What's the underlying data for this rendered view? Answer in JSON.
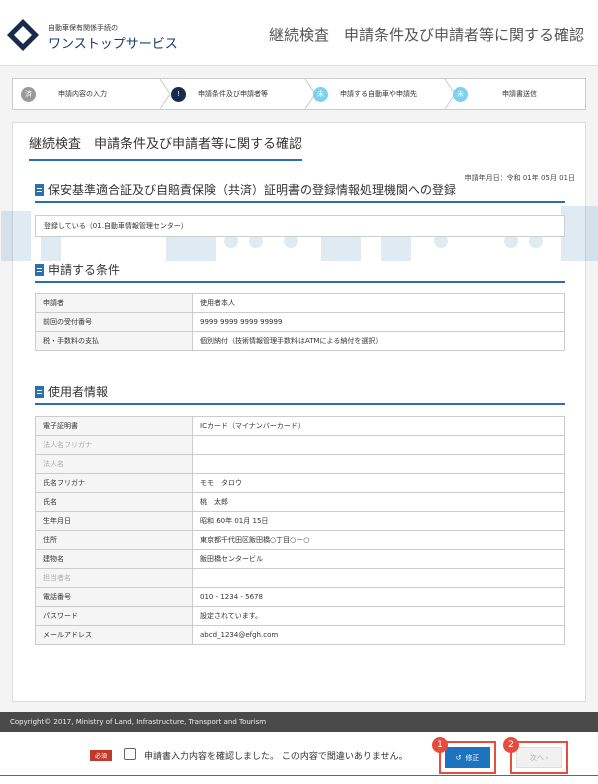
{
  "header": {
    "logo_sub": "自動車保有関係手続の",
    "logo_main": "ワンストップサービス",
    "page_heading": "継続検査　申請条件及び申請者等に関する確認"
  },
  "steps": [
    {
      "icon": "済",
      "label": "申請内容の入力",
      "color": "#999999"
    },
    {
      "icon": "!",
      "label": "申請条件及び申請者等",
      "color": "#1a2a4a"
    },
    {
      "icon": "未",
      "label": "申請する自動車や申請先",
      "color": "#7ecff0"
    },
    {
      "icon": "未",
      "label": "申請書送信",
      "color": "#7ecff0"
    }
  ],
  "card_title": "継続検査　申請条件及び申請者等に関する確認",
  "date_line": "申請年月日：令和 01年 05月 01日",
  "section1": {
    "title": "保安基準適合証及び自賠責保険（共済）証明書の登録情報処理機関への登録",
    "value": "登録している（01.自動車情報管理センター）"
  },
  "section2": {
    "title": "申請する条件",
    "rows": [
      {
        "k": "申請者",
        "v": "使用者本人"
      },
      {
        "k": "前回の受付番号",
        "v": "9999 9999 9999 99999"
      },
      {
        "k": "税・手数料の支払",
        "v": "個別納付（技術情報管理手数料はATMによる納付を選択）"
      }
    ]
  },
  "section3": {
    "title": "使用者情報",
    "rows": [
      {
        "k": "電子証明書",
        "v": "ICカード（マイナンバーカード）"
      },
      {
        "k": "法人名フリガナ",
        "v": ""
      },
      {
        "k": "法人名",
        "v": ""
      },
      {
        "k": "氏名フリガナ",
        "v": "モモ　タロウ"
      },
      {
        "k": "氏名",
        "v": "桃　太郎"
      },
      {
        "k": "生年月日",
        "v": "昭和 60年 01月 15日"
      },
      {
        "k": "住所",
        "v": "東京都千代田区飯田橋○丁目○－○"
      },
      {
        "k": "建物名",
        "v": "飯田橋センタービル"
      },
      {
        "k": "担当者名",
        "v": ""
      },
      {
        "k": "電話番号",
        "v": "010 - 1234 - 5678"
      },
      {
        "k": "パスワード",
        "v": "設定されています。"
      },
      {
        "k": "メールアドレス",
        "v": "abcd_1234@efgh.com"
      }
    ]
  },
  "footer": "Copyright© 2017, Ministry of Land, Infrastructure, Transport and Tourism",
  "bottom": {
    "required": "必須",
    "confirm": "申請書入力内容を確認しました。 この内容で間違いありません。",
    "fix_label": "修正",
    "next_label": "次へ ›",
    "badge1": "1",
    "badge2": "2"
  },
  "colors": {
    "accent": "#2a6fb0",
    "primary_button": "#1e73be",
    "callout": "#e74c3c"
  }
}
